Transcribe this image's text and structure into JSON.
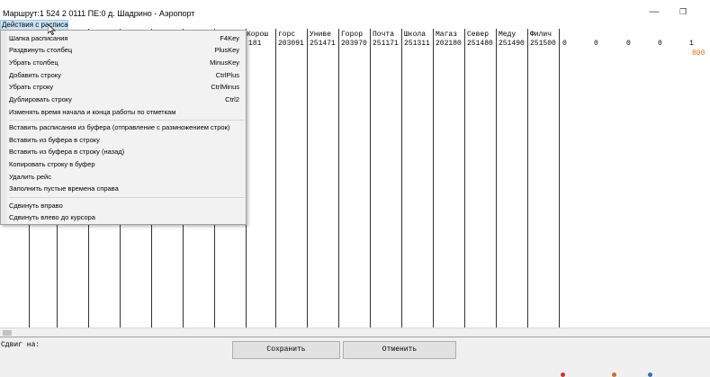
{
  "window": {
    "title": "Маршрут:1 524 2    0111 ПЕ:0 д. Шадрино - Аэропорт",
    "minimize_glyph": "—",
    "maximize_glyph": "❐"
  },
  "menubar": {
    "active_menu": "Действия с расписанием"
  },
  "menu": {
    "items": [
      {
        "label": "Шапка расписания",
        "shortcut": "F4Key"
      },
      {
        "label": "Раздвинуть столбец",
        "shortcut": "PlusKey"
      },
      {
        "label": "Убрать      столбец",
        "shortcut": "MinusKey"
      },
      {
        "label": "Добавить    строку",
        "shortcut": "CtrlPlus"
      },
      {
        "label": "Убрать       строку",
        "shortcut": "CtrlMinus"
      },
      {
        "label": "Дублировать строку",
        "shortcut": "Ctrl2"
      },
      {
        "label": "Изменять время начала и конца работы по отметкам",
        "shortcut": ""
      },
      {
        "label": "Вставить расписания из буфера (отправление с размножением  строк)",
        "shortcut": ""
      },
      {
        "label": "Вставить из буфера в строку",
        "shortcut": ""
      },
      {
        "label": "Вставить из буфера в строку (назад)",
        "shortcut": ""
      },
      {
        "label": "Копировать строку в буфер",
        "shortcut": ""
      },
      {
        "label": "Удалить рейс",
        "shortcut": ""
      },
      {
        "label": "Заполнить пустые времена справа",
        "shortcut": ""
      },
      {
        "label": "Сдвинуть вправо",
        "shortcut": ""
      },
      {
        "label": "Сдвинуть влево до курсора",
        "shortcut": ""
      }
    ]
  },
  "grid": {
    "columns": [
      {
        "header": "Корош",
        "code": "181"
      },
      {
        "header": "горс",
        "code": "203091"
      },
      {
        "header": "Униве",
        "code": "251471"
      },
      {
        "header": "Горор",
        "code": "203970"
      },
      {
        "header": "Почта",
        "code": "251171"
      },
      {
        "header": "Школа",
        "code": "251311"
      },
      {
        "header": "Магаз",
        "code": "202180"
      },
      {
        "header": "Север",
        "code": "251480"
      },
      {
        "header": "Меду",
        "code": "251490"
      },
      {
        "header": "Филич",
        "code": "251500"
      }
    ],
    "trailing_values": [
      "0",
      "0",
      "0",
      "0",
      "1"
    ],
    "highlight_value": "800",
    "highlight_color": "#e07000"
  },
  "bottom": {
    "shift_label": "Сдвиг на:",
    "save_label": "Сохранить",
    "cancel_label": "Отменить"
  }
}
